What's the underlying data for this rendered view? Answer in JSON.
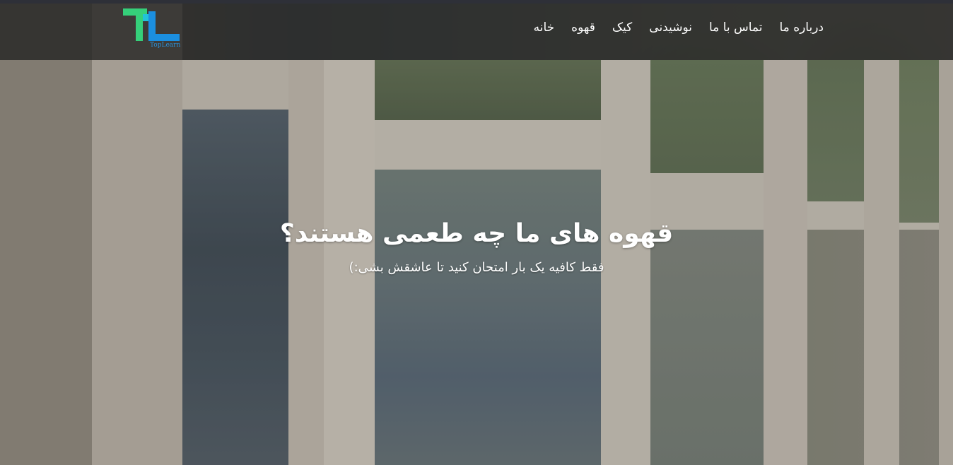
{
  "brand": {
    "logo_text": "TopLearn",
    "colors": {
      "logo_green": "#35d07a",
      "logo_blue": "#1b8fe0"
    }
  },
  "nav": {
    "items": [
      {
        "label": "خانه"
      },
      {
        "label": "قهوه"
      },
      {
        "label": "کیک"
      },
      {
        "label": "نوشیدنی"
      },
      {
        "label": "تماس با ما"
      },
      {
        "label": "درباره ما"
      }
    ]
  },
  "hero": {
    "title": "قهوه های ما چه طعمی هستند؟",
    "subtitle": "فقط کافیه یک بار امتحان کنید تا عاشقش بشی:)"
  },
  "colors": {
    "navbar_bg": "rgba(38,38,36,0.82)",
    "text": "#ffffff"
  }
}
